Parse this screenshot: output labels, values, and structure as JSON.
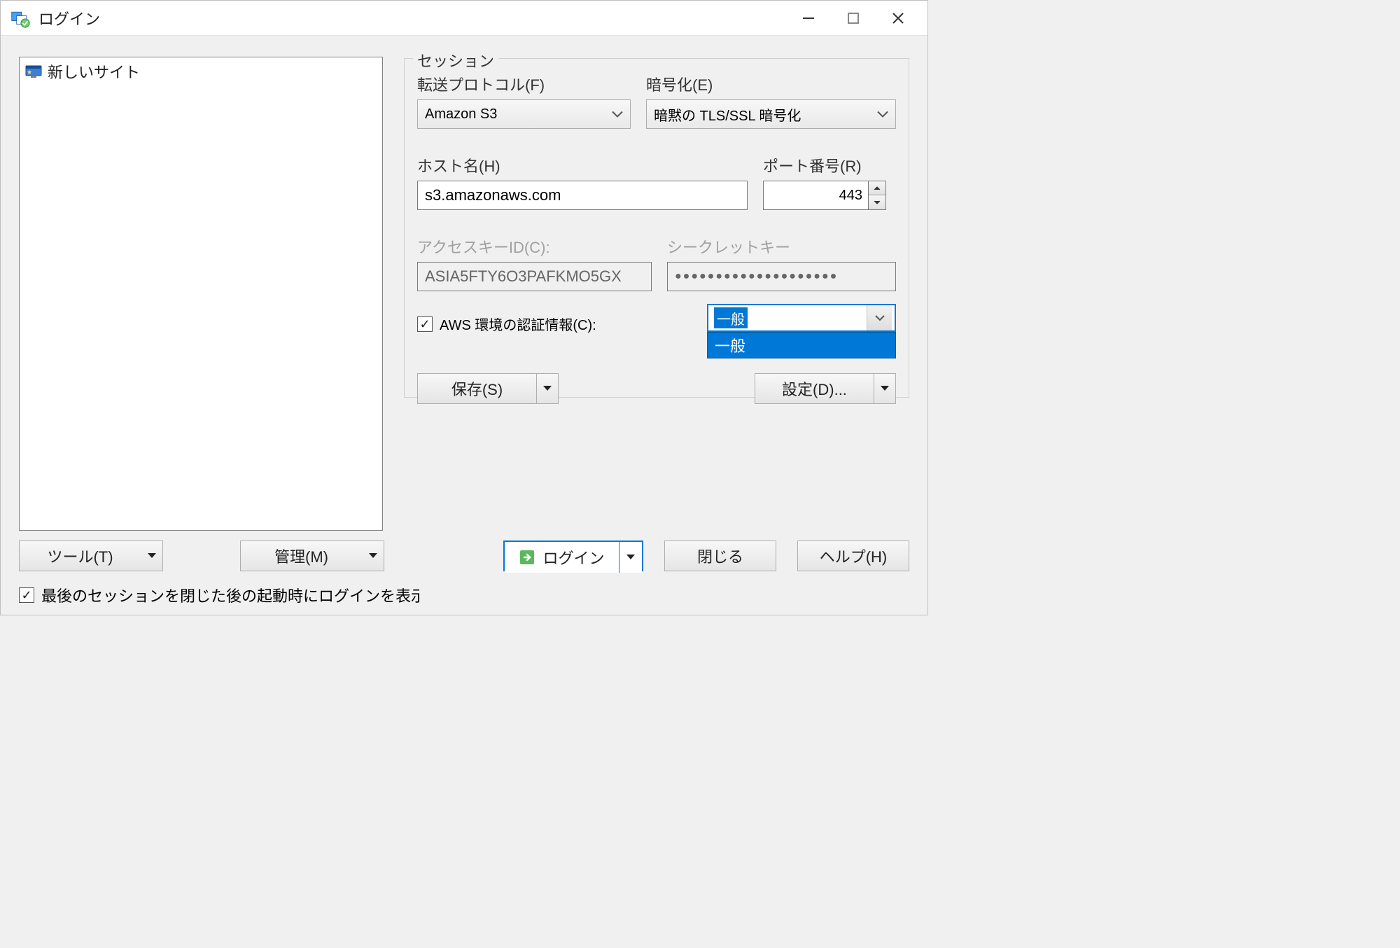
{
  "titlebar": {
    "title": "ログイン"
  },
  "site_list": {
    "items": [
      {
        "label": "新しいサイト"
      }
    ]
  },
  "session": {
    "group_label": "セッション",
    "protocol_label": "転送プロトコル(F)",
    "protocol_value": "Amazon S3",
    "encryption_label": "暗号化(E)",
    "encryption_value": "暗黙の TLS/SSL 暗号化",
    "host_label": "ホスト名(H)",
    "host_value": "s3.amazonaws.com",
    "port_label": "ポート番号(R)",
    "port_value": "443",
    "access_key_label": "アクセスキーID(C):",
    "access_key_value": "ASIA5FTY6O3PAFKMO5GX",
    "secret_key_label": "シークレットキー",
    "secret_key_masked": "●●●●●●●●●●●●●●●●●●●●",
    "aws_env_creds_label": "AWS 環境の認証情報(C):",
    "aws_env_creds_checked": true,
    "cred_profile_selected": "一般",
    "cred_profile_options": [
      "一般"
    ],
    "save_label": "保存(S)",
    "advanced_label": "設定(D)..."
  },
  "bottom": {
    "tools_label": "ツール(T)",
    "manage_label": "管理(M)",
    "login_label": "ログイン",
    "close_label": "閉じる",
    "help_label": "ヘルプ(H)"
  },
  "footer": {
    "show_login_label": "最後のセッションを閉じた後の起動時にログインを表示(S"
  }
}
